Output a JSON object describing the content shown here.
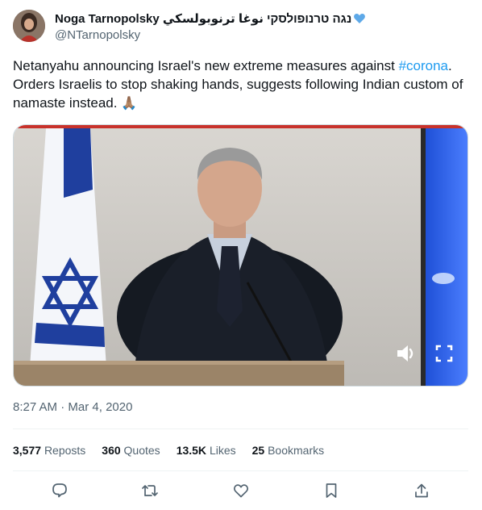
{
  "author": {
    "display_name": "Noga Tarnopolsky נגה טרנופולסקי نوغا ترنوبولسكي",
    "handle": "@NTarnopolsky",
    "badge_icon": "blue-heart-icon"
  },
  "tweet": {
    "text_before": "Netanyahu announcing Israel's new extreme measures against ",
    "hashtag": "#corona",
    "text_after": ". Orders Israelis to stop shaking hands, suggests following Indian custom of namaste instead. ",
    "emoji": "🙏🏽",
    "time": "8:27 AM",
    "separator": " · ",
    "date": "Mar 4, 2020"
  },
  "stats": {
    "reposts_count": "3,577",
    "reposts_label": "Reposts",
    "quotes_count": "360",
    "quotes_label": "Quotes",
    "likes_count": "13.5K",
    "likes_label": "Likes",
    "bookmarks_count": "25",
    "bookmarks_label": "Bookmarks"
  },
  "actions": [
    "reply-icon",
    "repost-icon",
    "like-icon",
    "bookmark-icon",
    "share-icon"
  ],
  "colors": {
    "accent": "#1d9bf0",
    "text": "#0f1419",
    "muted": "#536471"
  }
}
